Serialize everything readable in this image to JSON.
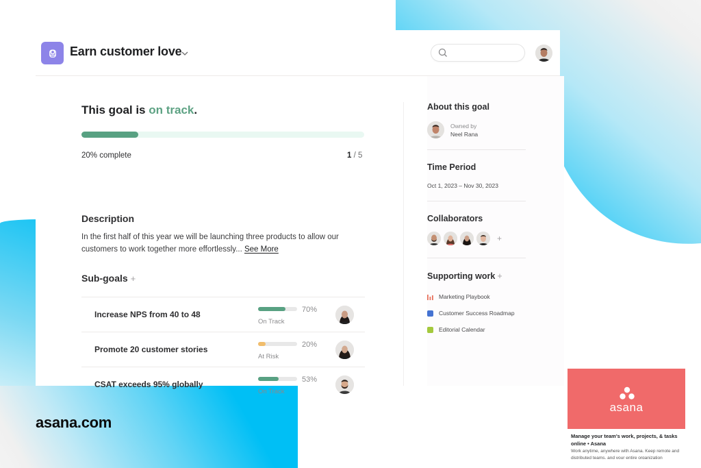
{
  "header": {
    "goal_title": "Earn customer love",
    "search_placeholder": ""
  },
  "status": {
    "prefix": "This goal is ",
    "state": "on track",
    "suffix": ".",
    "progress_percent": 20,
    "progress_label": "20% complete",
    "count_done": "1",
    "count_sep": " / ",
    "count_total": "5"
  },
  "description": {
    "heading": "Description",
    "text": "In the first half of this year we will be launching three products to allow our customers to work together more effortlessly... ",
    "see_more": "See More"
  },
  "subgoals": {
    "heading": "Sub-goals",
    "add_symbol": "+",
    "items": [
      {
        "name": "Increase NPS from 40 to 48",
        "percent": 70,
        "percent_label": "70%",
        "status": "On Track",
        "color": "#58a182"
      },
      {
        "name": "Promote 20 customer stories",
        "percent": 20,
        "percent_label": "20%",
        "status": "At Risk",
        "color": "#f1bd6c"
      },
      {
        "name": "CSAT exceeds 95% globally",
        "percent": 53,
        "percent_label": "53%",
        "status": "On Track",
        "color": "#58a182"
      }
    ]
  },
  "sidebar": {
    "about_heading": "About this goal",
    "owned_by_label": "Owned by",
    "owner_name": "Neel Rana",
    "time_heading": "Time Period",
    "time_period": "Oct 1, 2023 – Nov 30, 2023",
    "collab_heading": "Collaborators",
    "collab_add": "+",
    "support_heading": "Supporting work",
    "support_add": "+",
    "support_items": [
      {
        "label": "Marketing Playbook",
        "icon": "bar-chart-icon",
        "color": "#e8735e"
      },
      {
        "label": "Customer Success Roadmap",
        "icon": "blue-square-icon",
        "color": "#4573d2"
      },
      {
        "label": "Editorial Calendar",
        "icon": "green-square-icon",
        "color": "#a4c93d"
      }
    ]
  },
  "watermark": {
    "site": "asana.com"
  },
  "preview": {
    "logo_text": "asana",
    "title": "Manage your team's work, projects, & tasks online • Asana",
    "description": "Work anytime, anywhere with Asana. Keep remote and distributed teams, and your entire organization",
    "brand_color": "#f06a6a"
  },
  "colors": {
    "accent_green": "#58a182",
    "goal_icon_purple": "#8d84e8",
    "background_cyan": "#00bff5"
  }
}
